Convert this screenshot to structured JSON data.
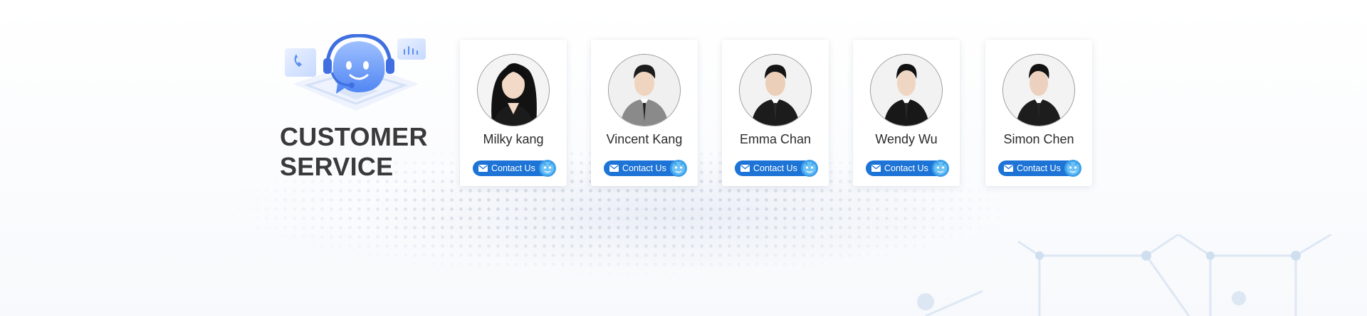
{
  "section": {
    "title_line1": "CUSTOMER",
    "title_line2": "SERVICE"
  },
  "agents": [
    {
      "name": "Milky kang",
      "contact_label": "Contact Us",
      "avatar_icon": "agent-photo-woman-dark-hair"
    },
    {
      "name": "Vincent Kang",
      "contact_label": "Contact Us",
      "avatar_icon": "agent-photo-man-grey-suit"
    },
    {
      "name": "Emma Chan",
      "contact_label": "Contact Us",
      "avatar_icon": "agent-photo-man-black-suit"
    },
    {
      "name": "Wendy Wu",
      "contact_label": "Contact Us",
      "avatar_icon": "agent-photo-man-black-suit"
    },
    {
      "name": "Simon Chen",
      "contact_label": "Contact Us",
      "avatar_icon": "agent-photo-man-black-suit"
    }
  ],
  "icons": {
    "hero": "customer-service-robot-headset-icon",
    "button": "mail-icon",
    "button_badge": "chat-mascot-icon"
  },
  "colors": {
    "button": "#1d74d6",
    "title": "#3a3a3a",
    "accent": "#4e8cf5"
  }
}
